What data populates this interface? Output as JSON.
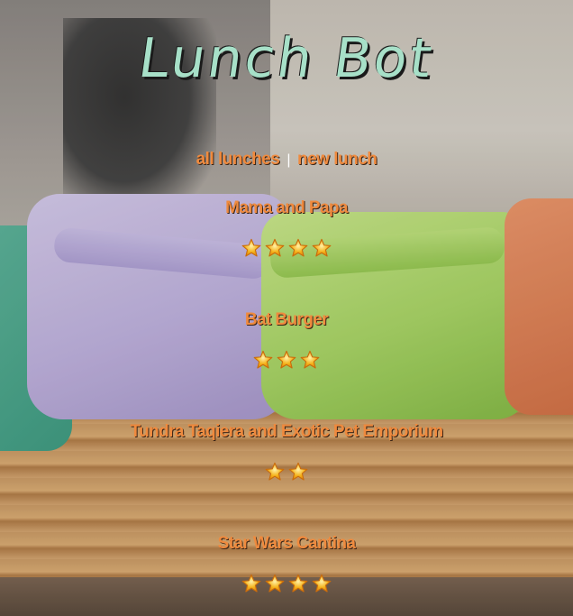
{
  "app": {
    "title": "Lunch Bot"
  },
  "nav": {
    "all_lunches": "all lunches",
    "separator": "|",
    "new_lunch": "new lunch"
  },
  "lunches": [
    {
      "name": "Mama and Papa",
      "rating": 4
    },
    {
      "name": "Bat Burger",
      "rating": 3
    },
    {
      "name": "Tundra Taqiera and Exotic Pet Emporium",
      "rating": 2
    },
    {
      "name": "Star Wars Cantina",
      "rating": 4
    }
  ],
  "icons": {
    "star": "star-icon"
  },
  "colors": {
    "title": "#a7e0c8",
    "link": "#ef8a3e",
    "star_fill": "#f5b21a",
    "star_stroke": "#c96b0c"
  }
}
